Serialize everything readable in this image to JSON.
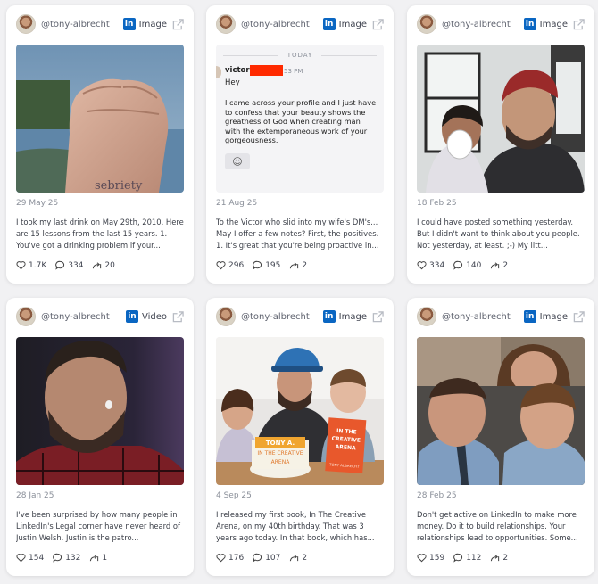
{
  "cards": [
    {
      "handle": "@tony-albrecht",
      "media_type": "Image",
      "date": "29 May 25",
      "text": "I took my last drink on May 29th, 2010. Here are 15 lessons from the last 15 years.  1. You've got a drinking problem if your...",
      "likes": "1.7K",
      "comments": "334",
      "reposts": "20"
    },
    {
      "handle": "@tony-albrecht",
      "media_type": "Image",
      "date": "21 Aug 25",
      "text": "To the Victor who slid into my wife's DM's... May I offer a few notes? First, the positives. 1. It's great that you're being proactive in...",
      "likes": "296",
      "comments": "195",
      "reposts": "2",
      "message": {
        "today": "TODAY",
        "name": "victor",
        "time": "53 PM",
        "greeting": "Hey",
        "body": "I came across your profile and I just have to confess that your beauty shows the greatness of God when creating man with the extemporaneous work of your gorgeousness."
      }
    },
    {
      "handle": "@tony-albrecht",
      "media_type": "Image",
      "date": "18 Feb 25",
      "text": "I could have posted something yesterday. But I didn't want to think about you people. Not yesterday, at least. ;-) My litt...",
      "likes": "334",
      "comments": "140",
      "reposts": "2"
    },
    {
      "handle": "@tony-albrecht",
      "media_type": "Video",
      "date": "28 Jan 25",
      "text": "I've been surprised by how many people in LinkedIn's Legal corner have never heard of Justin Welsh. Justin is the patro...",
      "likes": "154",
      "comments": "132",
      "reposts": "1"
    },
    {
      "handle": "@tony-albrecht",
      "media_type": "Image",
      "date": "4 Sep 25",
      "text": "I released my first book, In The Creative Arena, on my 40th birthday. That was 3 years ago today. In that book, which has...",
      "likes": "176",
      "comments": "107",
      "reposts": "2",
      "book": {
        "title": "IN THE CREATIVE ARENA",
        "author": "TONY ALBRECHT",
        "cake_text": "IN THE CREATIVE ARENA",
        "cake_author": "TONY A."
      }
    },
    {
      "handle": "@tony-albrecht",
      "media_type": "Image",
      "date": "28 Feb 25",
      "text": "Don't get active on LinkedIn to make more money. Do it to build relationships. Your relationships lead to opportunities. Some...",
      "likes": "159",
      "comments": "112",
      "reposts": "2"
    }
  ],
  "icons": {
    "linkedin": "linkedin-icon",
    "external": "external-link-icon",
    "like": "heart-icon",
    "comment": "comment-icon",
    "repost": "repost-icon"
  },
  "colors": {
    "linkedin_blue": "#0a66c2",
    "page_bg": "#f1f1f3",
    "card_bg": "#ffffff"
  }
}
